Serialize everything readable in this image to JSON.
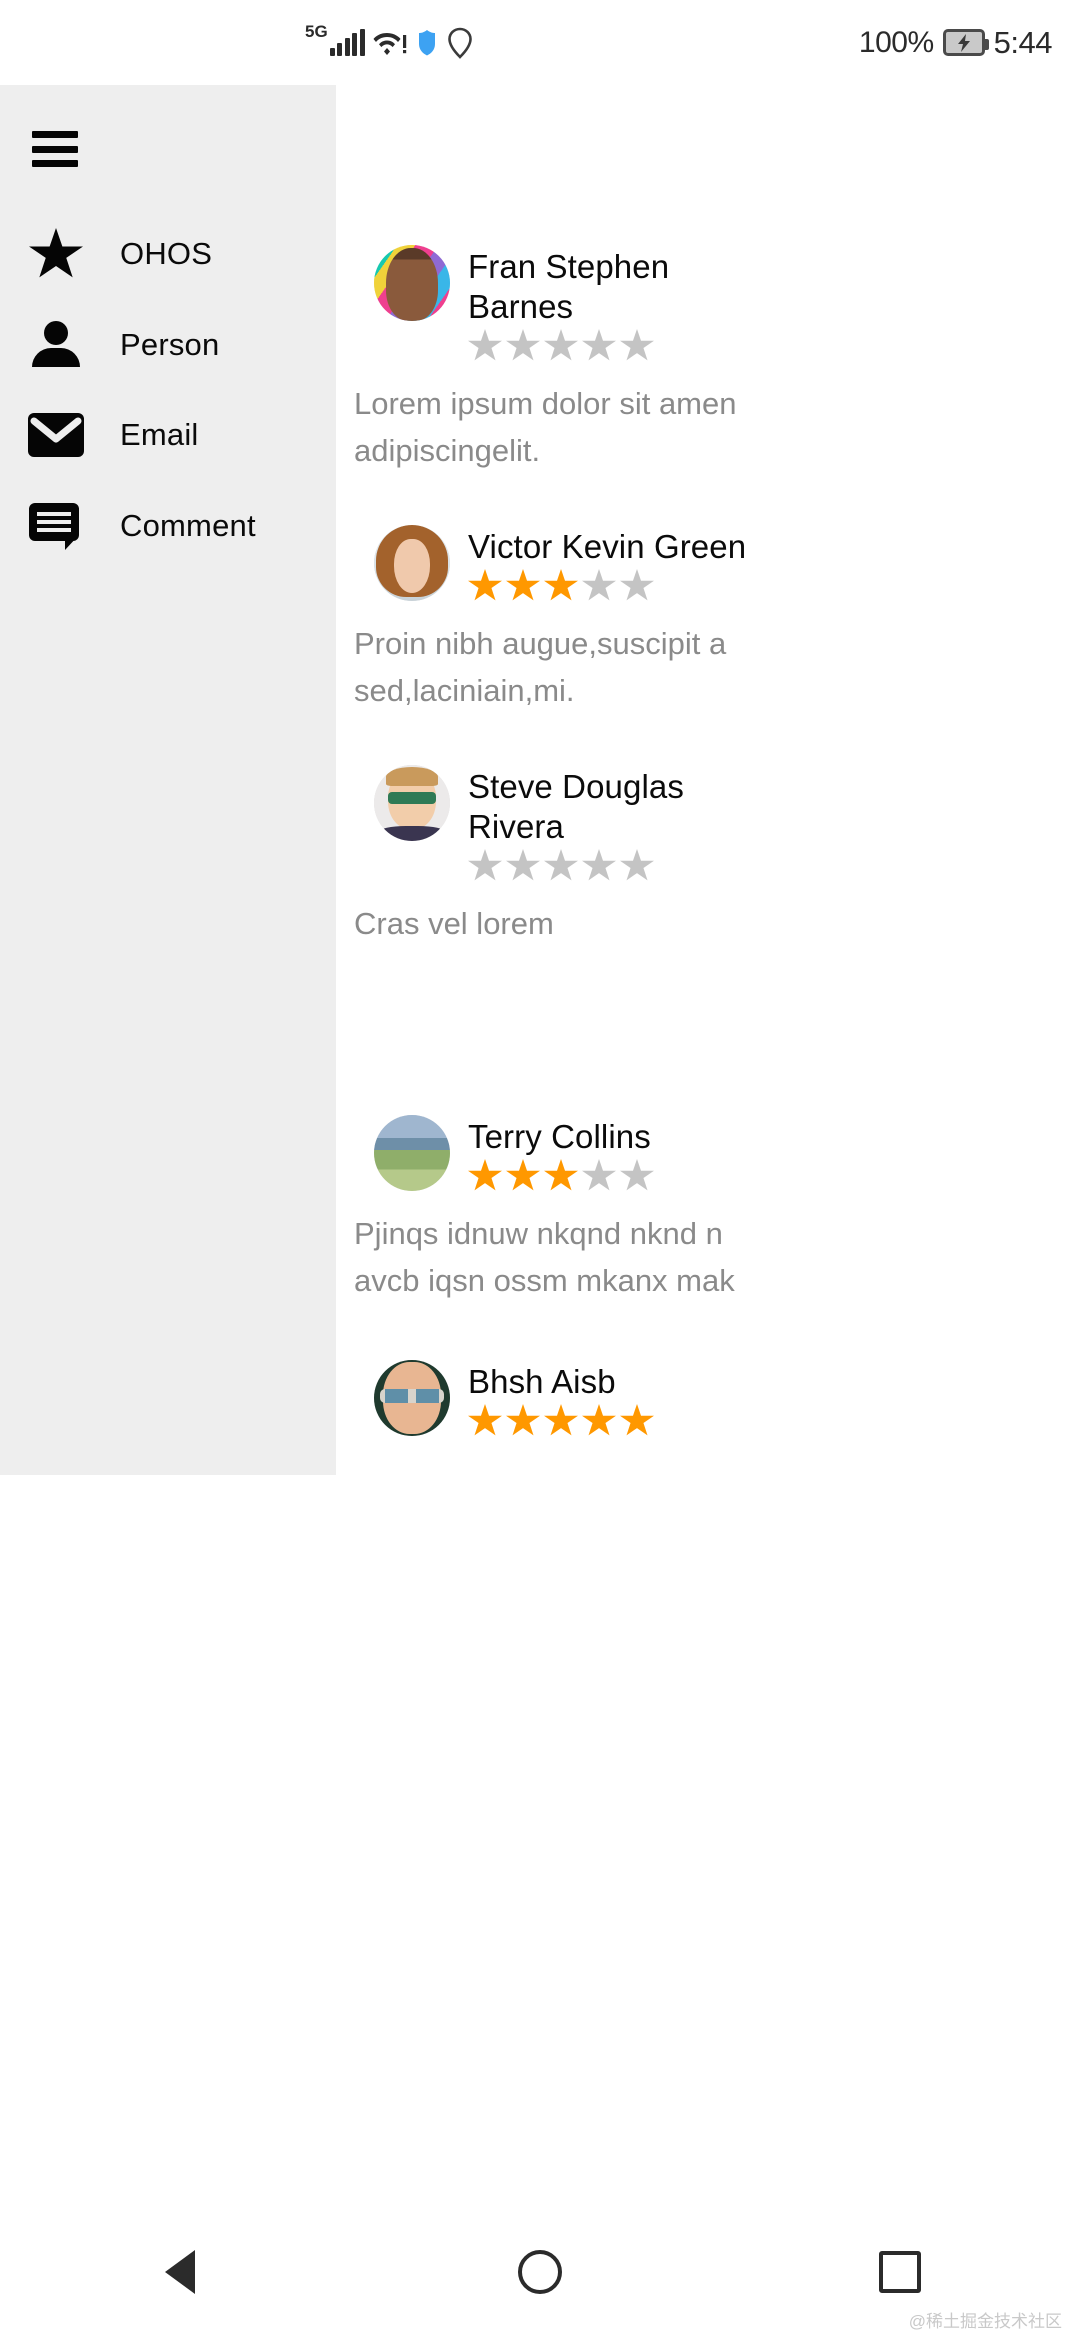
{
  "status_bar": {
    "network": "5G",
    "wifi_icon": "wifi-warning-icon",
    "shield_icon": "shield-icon",
    "location_icon": "location-pin-icon",
    "battery_percent": "100%",
    "battery_icon": "battery-charging-icon",
    "time": "5:44"
  },
  "sidebar": {
    "menu_icon": "hamburger-menu-icon",
    "items": [
      {
        "icon": "star-icon",
        "label": "OHOS"
      },
      {
        "icon": "person-icon",
        "label": "Person"
      },
      {
        "icon": "email-icon",
        "label": "Email"
      },
      {
        "icon": "comment-icon",
        "label": "Comment"
      }
    ]
  },
  "reviews": [
    {
      "name": "Fran Stephen Barnes",
      "rating": 0,
      "max_rating": 5,
      "body_line1": "Lorem ipsum dolor sit amen",
      "body_line2": "adipiscingelit."
    },
    {
      "name": "Victor Kevin Green",
      "rating": 3,
      "max_rating": 5,
      "body_line1": "Proin nibh augue,suscipit a",
      "body_line2": "sed,laciniain,mi."
    },
    {
      "name": "Steve Douglas Rivera",
      "rating": 0,
      "max_rating": 5,
      "body_line1": "Cras vel lorem",
      "body_line2": ""
    },
    {
      "name": "Terry Collins",
      "rating": 3,
      "max_rating": 5,
      "body_line1": "Pjinqs idnuw nkqnd nknd n",
      "body_line2": "avcb iqsn ossm mkanx mak"
    },
    {
      "name": "Bhsh Aisb",
      "rating": 5,
      "max_rating": 5,
      "body_line1": "",
      "body_line2": ""
    }
  ],
  "navigation_bar": {
    "back": "back-triangle",
    "home": "home-circle",
    "recents": "recents-square"
  },
  "watermark": "@稀土掘金技术社区",
  "colors": {
    "star_filled": "#FF9800",
    "star_empty": "#c4c4c4",
    "sidebar_bg": "#eeeeee",
    "body_text": "#8a8a8a"
  }
}
